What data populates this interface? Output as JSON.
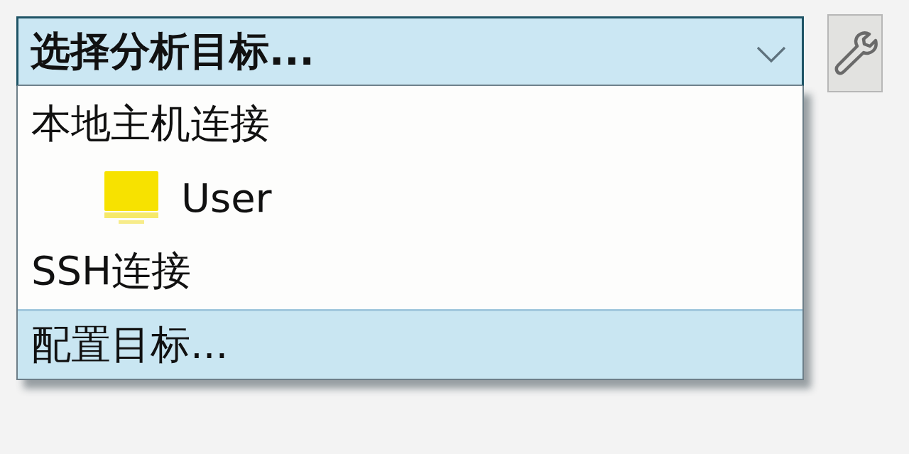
{
  "combo": {
    "value": "选择分析目标...",
    "expanded": true
  },
  "dropdown": {
    "items": [
      {
        "kind": "group",
        "label": "本地主机连接",
        "selected": false,
        "children": [
          {
            "kind": "target",
            "label": "User",
            "selected": false
          }
        ]
      },
      {
        "kind": "group",
        "label": "SSH连接",
        "selected": false
      },
      {
        "kind": "action",
        "label": "配置目标...",
        "selected": true
      }
    ]
  }
}
